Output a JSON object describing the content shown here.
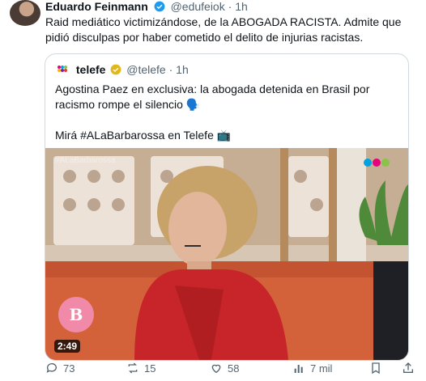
{
  "author": {
    "name": "Eduardo Feinmann",
    "handle": "@edufeiok",
    "separator": "·",
    "time": "1h"
  },
  "tweet_text": "Raid mediático victimizándose, de la ABOGADA RACISTA. Admite que pidió disculpas por haber cometido el delito de injurias racistas.",
  "quote": {
    "name": "telefe",
    "handle": "@telefe",
    "separator": "·",
    "time": "1h",
    "line1": "Agostina Paez en exclusiva: la abogada detenida en Brasil por racismo rompe el silencio 🗣️",
    "line2": "Mirá #ALaBarbarossa en Telefe 📺",
    "media": {
      "overlay_tag": "#ALaBarbarossa",
      "duration": "2:49"
    }
  },
  "actions": {
    "replies": "73",
    "reposts": "15",
    "likes": "58",
    "views": "7 mil"
  },
  "colors": {
    "verified_blue": "#1d9bf0",
    "verified_gold": "#e2b719",
    "muted": "#536471",
    "border": "#cfd9de"
  }
}
